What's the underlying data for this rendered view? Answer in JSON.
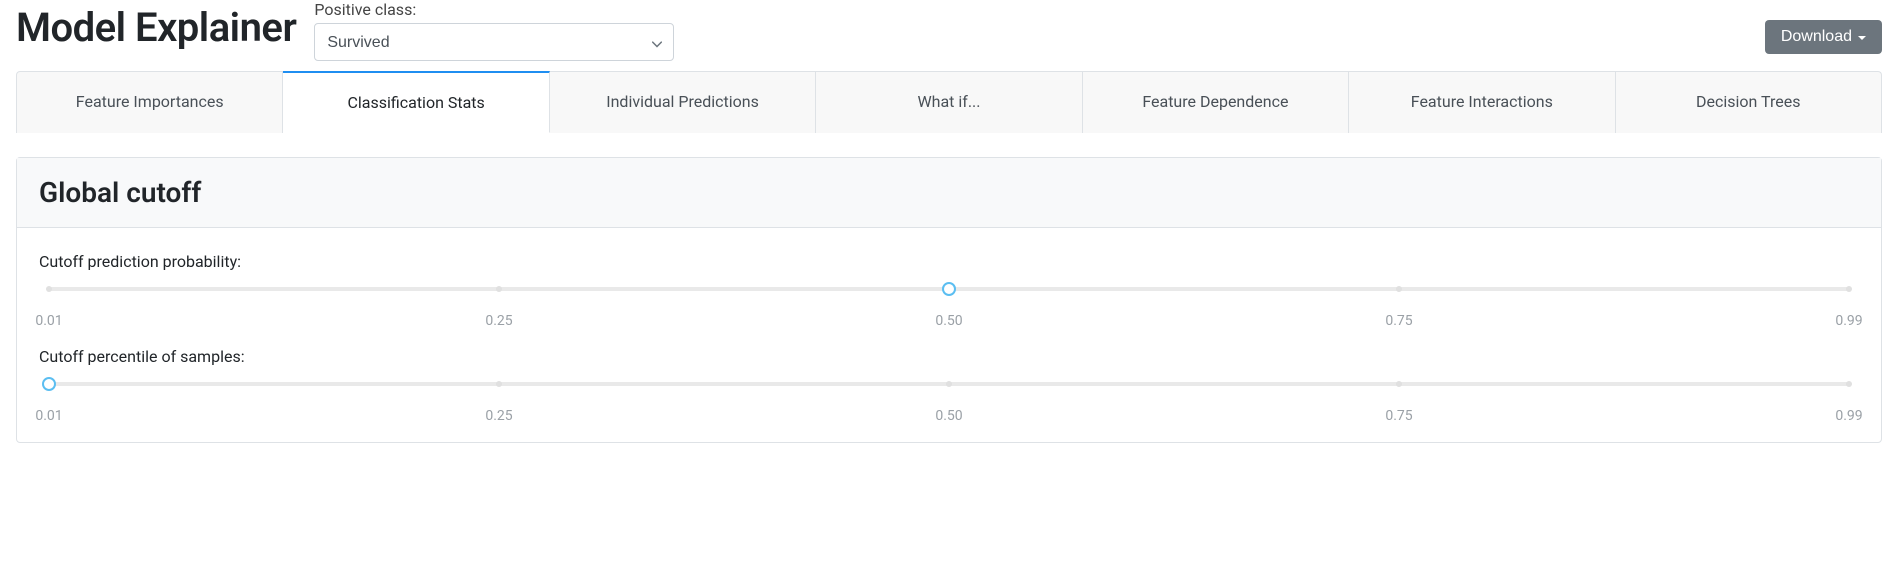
{
  "header": {
    "title": "Model Explainer",
    "positive_class_label": "Positive class:",
    "positive_class_value": "Survived",
    "download_label": "Download"
  },
  "tabs": [
    {
      "label": "Feature Importances",
      "active": false
    },
    {
      "label": "Classification Stats",
      "active": true
    },
    {
      "label": "Individual Predictions",
      "active": false
    },
    {
      "label": "What if...",
      "active": false
    },
    {
      "label": "Feature Dependence",
      "active": false
    },
    {
      "label": "Feature Interactions",
      "active": false
    },
    {
      "label": "Decision Trees",
      "active": false
    }
  ],
  "card": {
    "title": "Global cutoff",
    "sliders": [
      {
        "label": "Cutoff prediction probability:",
        "min": 0.01,
        "max": 0.99,
        "value": 0.5,
        "ticks": [
          "0.01",
          "0.25",
          "0.50",
          "0.75",
          "0.99"
        ]
      },
      {
        "label": "Cutoff percentile of samples:",
        "min": 0.01,
        "max": 0.99,
        "value": 0.01,
        "ticks": [
          "0.01",
          "0.25",
          "0.50",
          "0.75",
          "0.99"
        ]
      }
    ]
  }
}
